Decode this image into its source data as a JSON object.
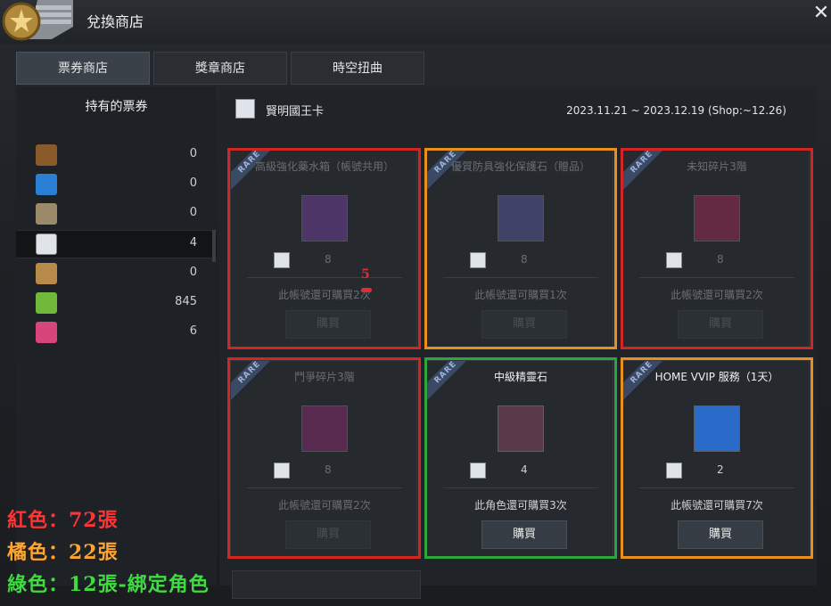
{
  "window": {
    "title": "兌換商店",
    "close_icon": "close-icon"
  },
  "tabs": [
    {
      "label": "票券商店",
      "active": true
    },
    {
      "label": "獎章商店",
      "active": false
    },
    {
      "label": "時空扭曲",
      "active": false
    }
  ],
  "owned": {
    "header": "持有的票券",
    "tickets": [
      {
        "icon": "acorn-ticket-icon",
        "count": "0",
        "color": "#8a5a2b"
      },
      {
        "icon": "blue-ticket-icon",
        "count": "0",
        "color": "#2a7fd4"
      },
      {
        "icon": "hat-ticket-icon",
        "count": "0",
        "color": "#9a8a6a"
      },
      {
        "icon": "crown-ticket-icon",
        "count": "4",
        "color": "#dfe3ea",
        "selected": true
      },
      {
        "icon": "gift-ticket-icon",
        "count": "0",
        "color": "#b88a4a"
      },
      {
        "icon": "today-ticket-icon",
        "count": "845",
        "color": "#6fb83a"
      },
      {
        "icon": "pink-ticket-icon",
        "count": "6",
        "color": "#d8457a"
      }
    ]
  },
  "shop": {
    "title": "賢明國王卡",
    "date_range": "2023.11.21 ~ 2023.12.19 (Shop:~12.26)",
    "rare_label": "RARE",
    "buy_label": "購買",
    "items": [
      {
        "name": "高級強化藥水箱（帳號共用）",
        "price": "8",
        "limit": "此帳號還可購買2次",
        "dim": true,
        "item_icon": "potion-box-icon",
        "item_color": "#5a3a7a"
      },
      {
        "name": "優質防具強化保護石（贈品）",
        "price": "8",
        "limit": "此帳號還可購買1次",
        "dim": true,
        "item_icon": "protection-stone-icon",
        "item_color": "#4a4a7a"
      },
      {
        "name": "未知碎片3階",
        "price": "8",
        "limit": "此帳號還可購買2次",
        "dim": true,
        "item_icon": "unknown-shard-icon",
        "item_color": "#7a2a4a"
      },
      {
        "name": "鬥爭碎片3階",
        "price": "8",
        "limit": "此帳號還可購買2次",
        "dim": true,
        "item_icon": "battle-shard-icon",
        "item_color": "#6a2a5a"
      },
      {
        "name": "中級精靈石",
        "price": "4",
        "limit": "此角色還可購買3次",
        "dim": false,
        "item_icon": "spirit-stone-icon",
        "item_color": "#5a3a4a"
      },
      {
        "name": "HOME VVIP 服務（1天）",
        "price": "2",
        "limit": "此帳號還可購買7次",
        "dim": false,
        "item_icon": "capsule-icon",
        "item_color": "#2a6ac8"
      }
    ]
  },
  "annotations": {
    "number": "5",
    "legend": [
      {
        "text": "紅色：72張",
        "color": "#ff3535"
      },
      {
        "text": "橘色：22張",
        "color": "#ffa52f"
      },
      {
        "text": "綠色：12張-綁定角色",
        "color": "#3fdc3f"
      }
    ]
  }
}
